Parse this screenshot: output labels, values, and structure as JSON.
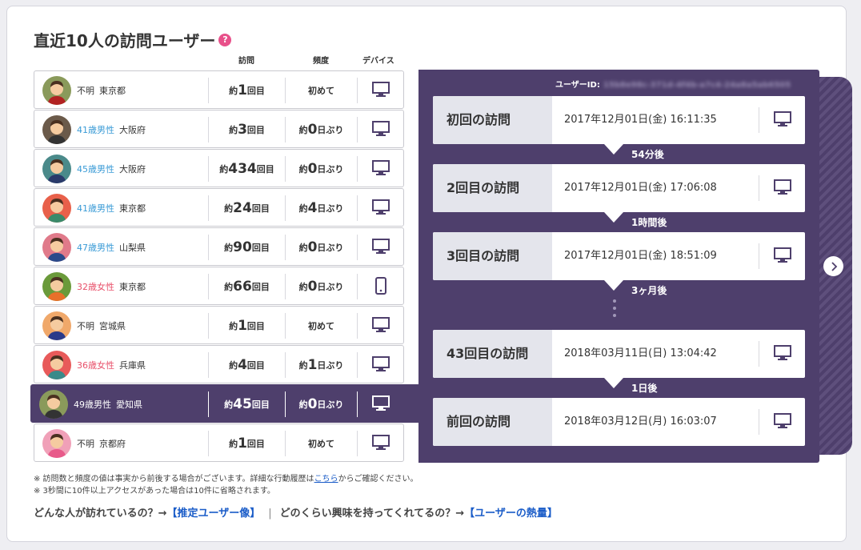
{
  "title": "直近10人の訪問ユーザー",
  "help_icon": "help-icon",
  "columns": {
    "visits": "訪問",
    "freq": "頻度",
    "device": "デバイス"
  },
  "visitors": [
    {
      "demo": "不明",
      "demo_type": "u",
      "pref": "東京都",
      "visit_pre": "約",
      "visit_num": "1",
      "visit_post": "回目",
      "freq_pre": "",
      "freq_num": "",
      "freq_post": "初めて",
      "device": "desktop-icon",
      "avatar_bg": "#8a9a5b",
      "shirt": "#b22222"
    },
    {
      "demo": "41歳男性",
      "demo_type": "m",
      "pref": "大阪府",
      "visit_pre": "約",
      "visit_num": "3",
      "visit_post": "回目",
      "freq_pre": "約",
      "freq_num": "0",
      "freq_post": "日ぶり",
      "device": "desktop-icon",
      "avatar_bg": "#6b5a4a",
      "shirt": "#333333"
    },
    {
      "demo": "45歳男性",
      "demo_type": "m",
      "pref": "大阪府",
      "visit_pre": "約",
      "visit_num": "434",
      "visit_post": "回目",
      "freq_pre": "約",
      "freq_num": "0",
      "freq_post": "日ぶり",
      "device": "desktop-icon",
      "avatar_bg": "#4a8a8a",
      "shirt": "#2a3a6a"
    },
    {
      "demo": "41歳男性",
      "demo_type": "m",
      "pref": "東京都",
      "visit_pre": "約",
      "visit_num": "24",
      "visit_post": "回目",
      "freq_pre": "約",
      "freq_num": "4",
      "freq_post": "日ぶり",
      "device": "desktop-icon",
      "avatar_bg": "#e8604a",
      "shirt": "#3a8a6a"
    },
    {
      "demo": "47歳男性",
      "demo_type": "m",
      "pref": "山梨県",
      "visit_pre": "約",
      "visit_num": "90",
      "visit_post": "回目",
      "freq_pre": "約",
      "freq_num": "0",
      "freq_post": "日ぶり",
      "device": "desktop-icon",
      "avatar_bg": "#e07a8a",
      "shirt": "#2a4a8a"
    },
    {
      "demo": "32歳女性",
      "demo_type": "f",
      "pref": "東京都",
      "visit_pre": "約",
      "visit_num": "66",
      "visit_post": "回目",
      "freq_pre": "約",
      "freq_num": "0",
      "freq_post": "日ぶり",
      "device": "smartphone-icon",
      "avatar_bg": "#6a9a3a",
      "shirt": "#e8702a"
    },
    {
      "demo": "不明",
      "demo_type": "u",
      "pref": "宮城県",
      "visit_pre": "約",
      "visit_num": "1",
      "visit_post": "回目",
      "freq_pre": "",
      "freq_num": "",
      "freq_post": "初めて",
      "device": "desktop-icon",
      "avatar_bg": "#f0a86a",
      "shirt": "#2a3a8a"
    },
    {
      "demo": "36歳女性",
      "demo_type": "f",
      "pref": "兵庫県",
      "visit_pre": "約",
      "visit_num": "4",
      "visit_post": "回目",
      "freq_pre": "約",
      "freq_num": "1",
      "freq_post": "日ぶり",
      "device": "desktop-icon",
      "avatar_bg": "#e85a5a",
      "shirt": "#3a8a8a"
    },
    {
      "demo": "49歳男性",
      "demo_type": "m",
      "pref": "愛知県",
      "visit_pre": "約",
      "visit_num": "45",
      "visit_post": "回目",
      "freq_pre": "約",
      "freq_num": "0",
      "freq_post": "日ぶり",
      "device": "desktop-icon",
      "avatar_bg": "#8a9a5b",
      "shirt": "#333333",
      "selected": true
    },
    {
      "demo": "不明",
      "demo_type": "u",
      "pref": "京都府",
      "visit_pre": "約",
      "visit_num": "1",
      "visit_post": "回目",
      "freq_pre": "",
      "freq_num": "",
      "freq_post": "初めて",
      "device": "desktop-icon",
      "avatar_bg": "#f0a0b8",
      "shirt": "#e85a8a"
    }
  ],
  "notes": {
    "n1_pre": "※ 訪問数と頻度の値は事実から前後する場合がございます。詳細な行動履歴は",
    "n1_link": "こちら",
    "n1_post": "からご確認ください。",
    "n2": "※ 3秒間に10件以上アクセスがあった場合は10件に省略されます。"
  },
  "bottom_links": {
    "q1": "どんな人が訪れているの？→",
    "l1": "【推定ユーザー像】",
    "sep": "|",
    "q2": "どのくらい興味を持ってくれてるの？→",
    "l2": "【ユーザーの熱量】"
  },
  "detail": {
    "user_id_label": "ユーザーID:",
    "user_id_value": "15b8e98c-371d-4f4b-a7c4-24a8a5ab6505",
    "visits": [
      {
        "label": "初回の訪問",
        "time": "2017年12月01日(金) 16:11:35",
        "device": "desktop-icon"
      },
      {
        "label": "2回目の訪問",
        "time": "2017年12月01日(金) 17:06:08",
        "device": "desktop-icon"
      },
      {
        "label": "3回目の訪問",
        "time": "2017年12月01日(金) 18:51:09",
        "device": "desktop-icon"
      },
      {
        "label": "43回目の訪問",
        "time": "2018年03月11日(日) 13:04:42",
        "device": "desktop-icon"
      },
      {
        "label": "前回の訪問",
        "time": "2018年03月12日(月) 16:03:07",
        "device": "desktop-icon"
      }
    ],
    "gaps": [
      "54分後",
      "1時間後",
      "3ヶ月後",
      "1日後"
    ],
    "next_icon": "chevron-right-icon"
  },
  "colors": {
    "panel": "#4e3f6c",
    "male": "#3a9bd6",
    "female": "#e8506a",
    "link": "#1a5cc8",
    "help": "#e8508a"
  }
}
